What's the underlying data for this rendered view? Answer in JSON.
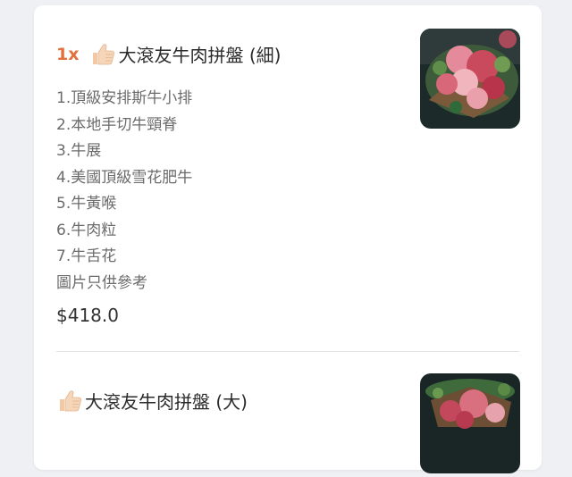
{
  "items": [
    {
      "quantity": "1x",
      "title": "大滾友牛肉拼盤 (細)",
      "description": [
        "1.頂級安排斯牛小排",
        "2.本地手切牛頸脊",
        "3.牛展",
        "4.美國頂級雪花肥牛",
        "5.牛黃喉",
        "6.牛肉粒",
        "7.牛舌花",
        "圖片只供參考"
      ],
      "price": "$418.0",
      "icon": "thumbs-up-icon",
      "image": "beef-platter-photo"
    },
    {
      "title": "大滾友牛肉拼盤 (大)",
      "icon": "thumbs-up-icon",
      "image": "beef-platter-photo"
    }
  ]
}
